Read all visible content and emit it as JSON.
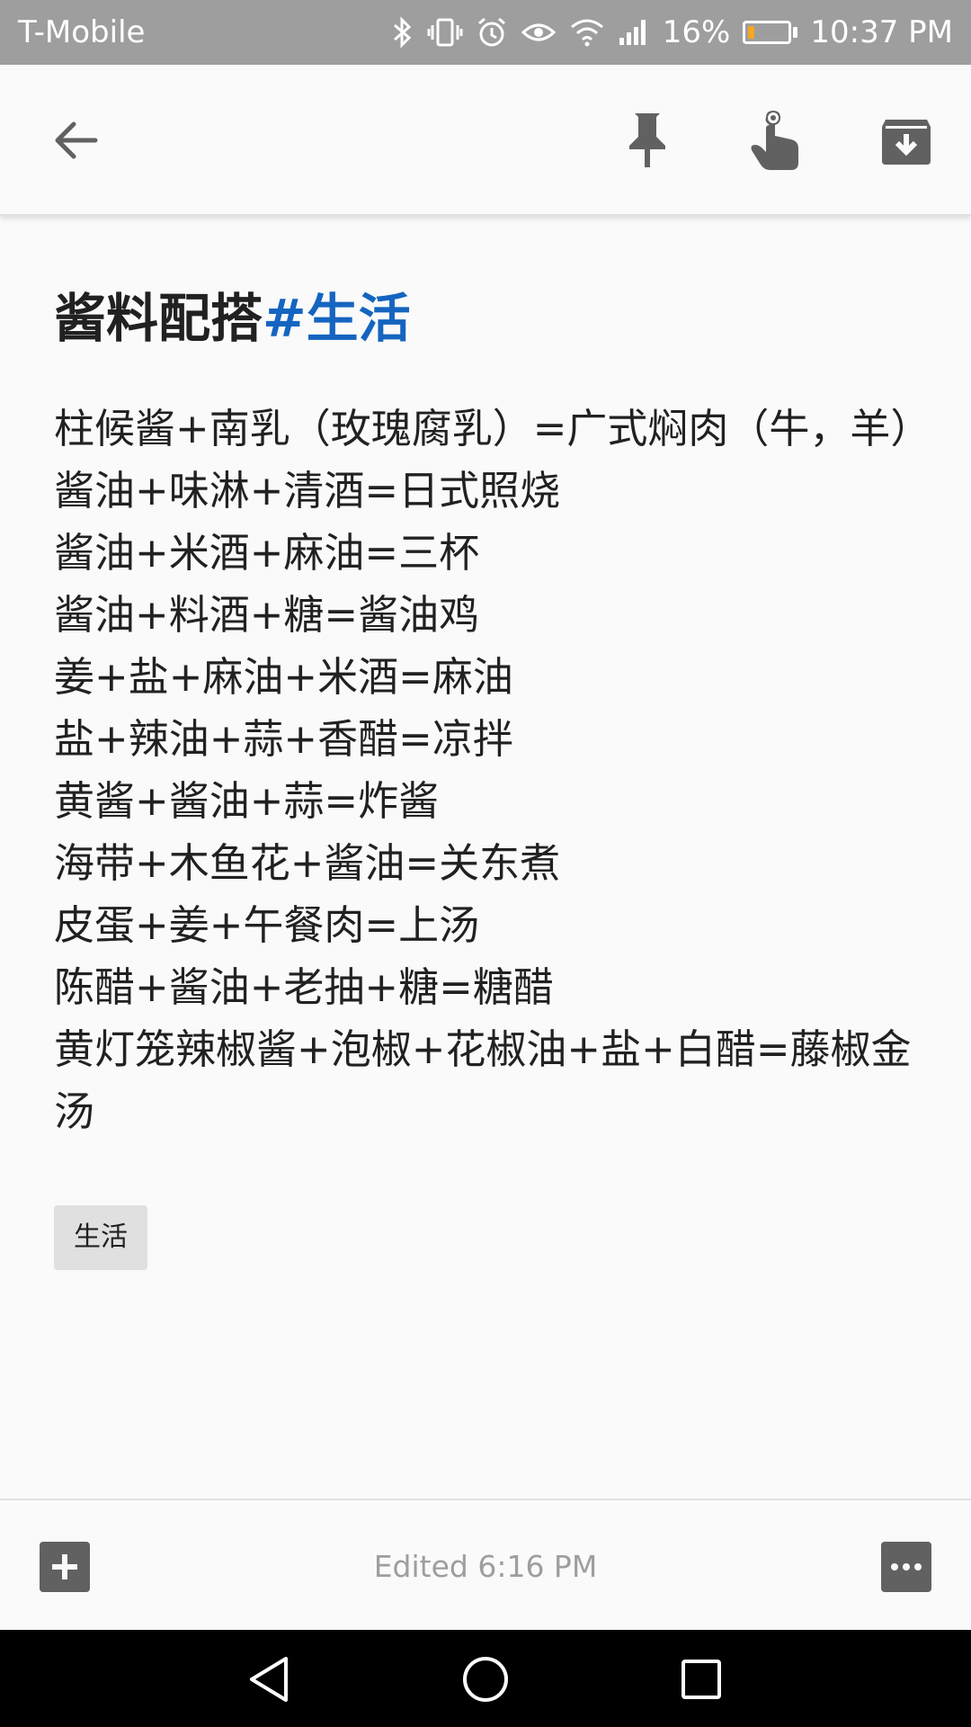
{
  "status_bar": {
    "carrier": "T-Mobile",
    "battery_percent": "16%",
    "battery_level": 0.16,
    "time": "10:37 PM",
    "icons": [
      "bluetooth-icon",
      "vibrate-icon",
      "alarm-icon",
      "eye-icon",
      "wifi-icon",
      "signal-icon",
      "battery-icon"
    ]
  },
  "toolbar": {
    "back": "arrow-back-icon",
    "pin": "pin-icon",
    "reminder": "reminder-icon",
    "archive": "archive-icon"
  },
  "note": {
    "title_main": "酱料配搭",
    "title_hashtag": "#生活",
    "lines": [
      "柱候酱+南乳（玫瑰腐乳）=广式焖肉（牛，羊）",
      "酱油+味淋+清酒=日式照烧",
      "酱油+米酒+麻油=三杯",
      "酱油+料酒+糖=酱油鸡",
      "姜+盐+麻油+米酒=麻油",
      "盐+辣油+蒜+香醋=凉拌",
      "黄酱+酱油+蒜=炸酱",
      "海带+木鱼花+酱油=关东煮",
      "皮蛋+姜+午餐肉=上汤",
      "陈醋+酱油+老抽+糖=糖醋",
      "黄灯笼辣椒酱+泡椒+花椒油+盐+白醋=藤椒金汤"
    ],
    "label": "生活"
  },
  "bottom_bar": {
    "edited": "Edited 6:16 PM",
    "add": "add-box-icon",
    "more": "more-icon"
  },
  "nav_bar": {
    "back": "nav-back-icon",
    "home": "nav-home-icon",
    "recents": "nav-recents-icon"
  }
}
